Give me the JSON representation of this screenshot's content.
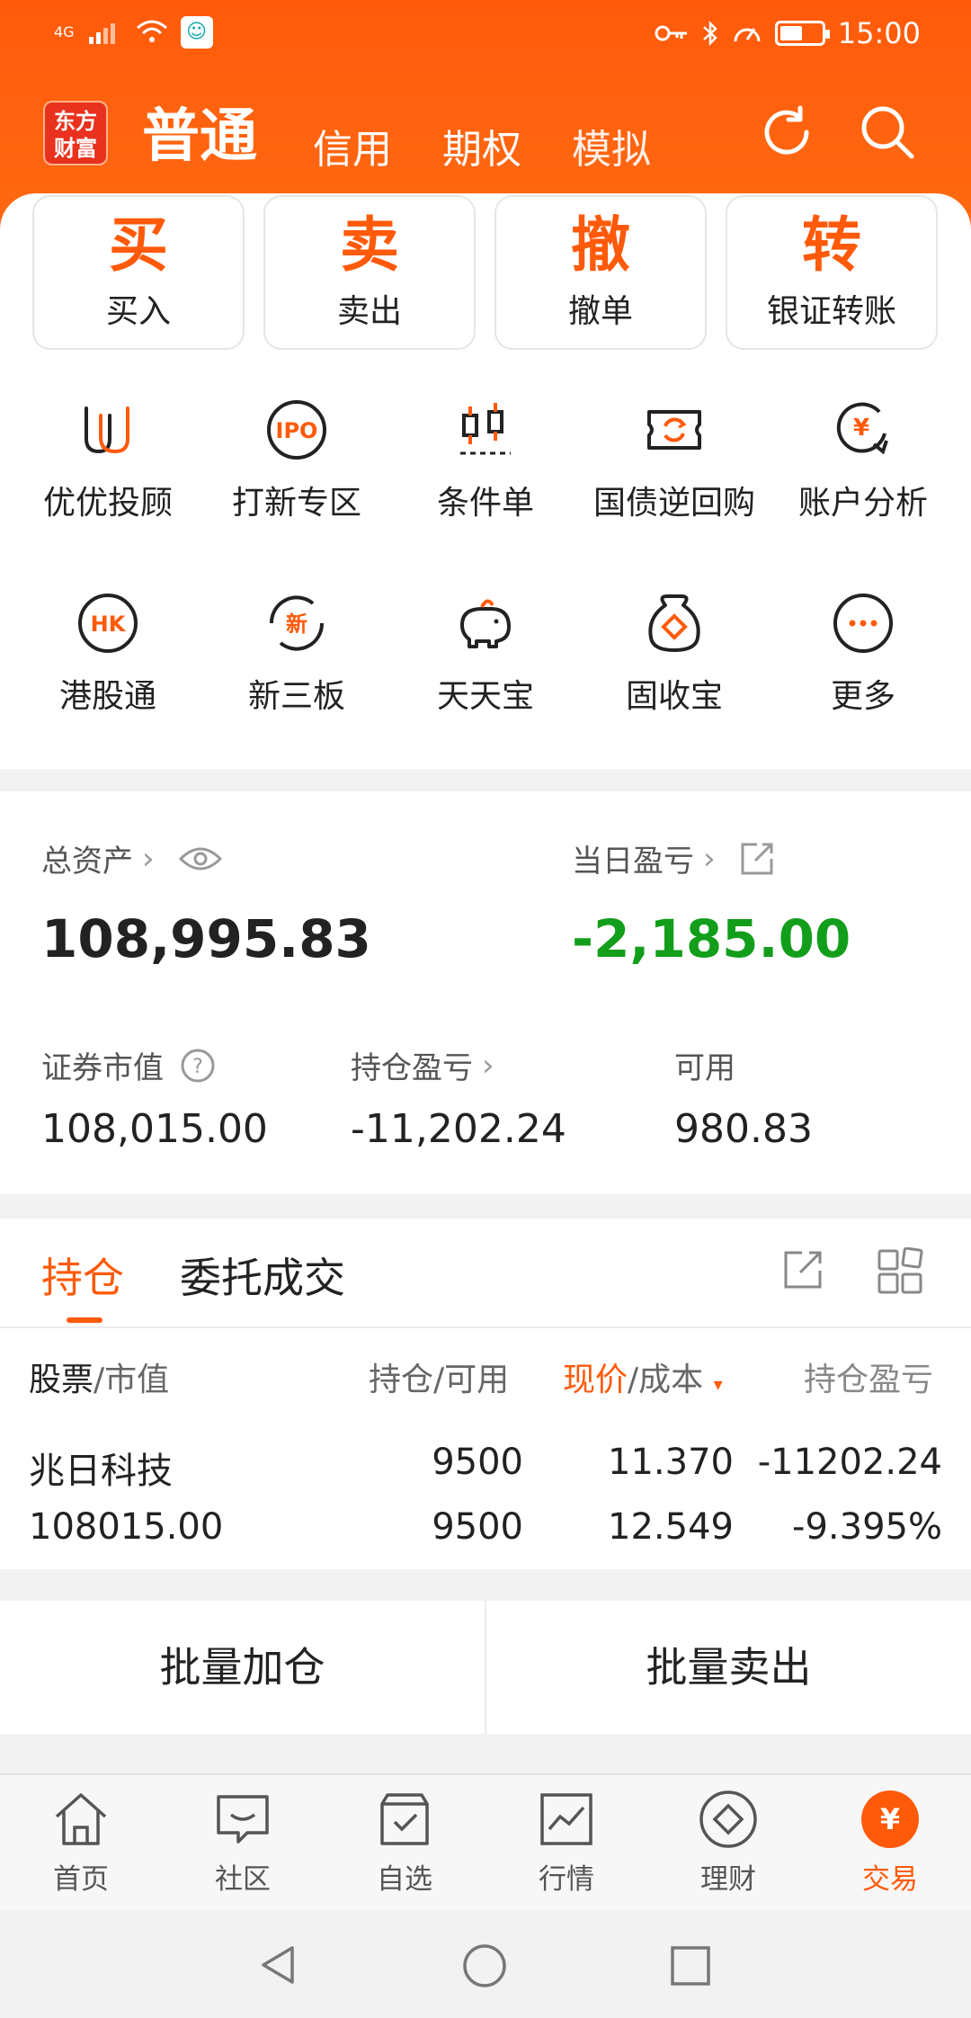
{
  "status": {
    "network": "4G",
    "time": "15:00",
    "battery_level": 0.55
  },
  "header": {
    "logo_text": [
      "东方",
      "财富"
    ],
    "tabs": [
      {
        "label": "普通"
      },
      {
        "label": "信用"
      },
      {
        "label": "期权"
      },
      {
        "label": "模拟"
      }
    ],
    "icons": [
      "refresh-icon",
      "search-icon"
    ]
  },
  "quick_actions": [
    {
      "big": "买",
      "label": "买入"
    },
    {
      "big": "卖",
      "label": "卖出"
    },
    {
      "big": "撤",
      "label": "撤单"
    },
    {
      "big": "转",
      "label": "银证转账"
    }
  ],
  "features": [
    {
      "label": "优优投顾",
      "icon": "advisor-icon"
    },
    {
      "label": "打新专区",
      "icon": "ipo-icon",
      "icon_text": "IPO"
    },
    {
      "label": "条件单",
      "icon": "condition-order-icon"
    },
    {
      "label": "国债逆回购",
      "icon": "repo-icon"
    },
    {
      "label": "账户分析",
      "icon": "account-analysis-icon"
    },
    {
      "label": "港股通",
      "icon": "hk-connect-icon",
      "icon_text": "HK"
    },
    {
      "label": "新三板",
      "icon": "neeq-icon",
      "icon_text": "新"
    },
    {
      "label": "天天宝",
      "icon": "piggy-bank-icon"
    },
    {
      "label": "固收宝",
      "icon": "fixed-income-icon"
    },
    {
      "label": "更多",
      "icon": "more-icon"
    }
  ],
  "assets": {
    "total_label": "总资产",
    "total_value": "108,995.83",
    "daily_pl_label": "当日盈亏",
    "daily_pl_value": "-2,185.00",
    "market_value_label": "证券市值",
    "market_value": "108,015.00",
    "position_pl_label": "持仓盈亏",
    "position_pl_value": "-11,202.24",
    "available_label": "可用",
    "available_value": "980.83"
  },
  "holdings": {
    "tabs": [
      "持仓",
      "委托成交"
    ],
    "headers": {
      "stock": "股票",
      "stock_sub": "/市值",
      "qty": "持仓/可用",
      "price": "现价",
      "price_sub": "/成本",
      "pl": "持仓盈亏"
    },
    "rows": [
      {
        "name": "兆日科技",
        "market_value": "108015.00",
        "qty": "9500",
        "available": "9500",
        "price": "11.370",
        "cost": "12.549",
        "pl": "-11202.24",
        "pl_pct": "-9.395%"
      }
    ]
  },
  "batch": {
    "add": "批量加仓",
    "sell": "批量卖出"
  },
  "bottom_nav": [
    {
      "label": "首页",
      "icon": "home-icon"
    },
    {
      "label": "社区",
      "icon": "community-icon"
    },
    {
      "label": "自选",
      "icon": "watchlist-icon"
    },
    {
      "label": "行情",
      "icon": "market-icon"
    },
    {
      "label": "理财",
      "icon": "wealth-icon"
    },
    {
      "label": "交易",
      "icon": "trade-icon",
      "icon_text": "¥"
    }
  ],
  "colors": {
    "brand": "#ff5a0a",
    "loss": "#129e1a",
    "text": "#222222",
    "muted": "#666666"
  }
}
